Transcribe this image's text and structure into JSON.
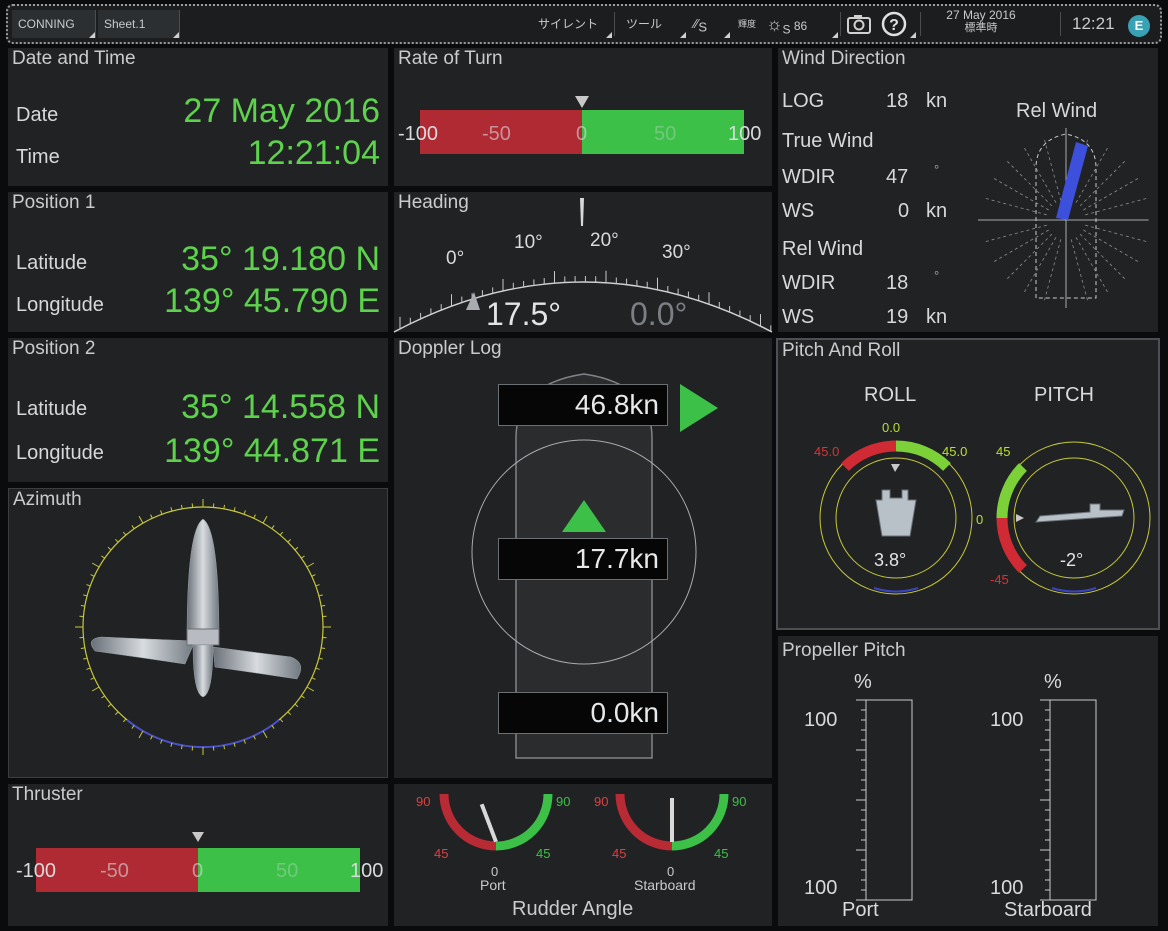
{
  "topbar": {
    "mode_button": "CONNING",
    "sheet_tab": "Sheet.1",
    "silent_button": "サイレント",
    "tools_button": "ツール",
    "panel_dimmer": "S",
    "brightness_label": "輝度",
    "brightness_value": "86",
    "date": "27 May 2016",
    "time_zone": "標準時",
    "clock": "12:21",
    "status_letter": "E"
  },
  "date_time": {
    "title": "Date and Time",
    "date_label": "Date",
    "date_value": "27 May 2016",
    "time_label": "Time",
    "time_value": "12:21:04"
  },
  "position1": {
    "title": "Position 1",
    "lat_label": "Latitude",
    "lat_value": "35° 19.180 N",
    "lon_label": "Longitude",
    "lon_value": "139° 45.790 E"
  },
  "position2": {
    "title": "Position 2",
    "lat_label": "Latitude",
    "lat_value": "35° 14.558 N",
    "lon_label": "Longitude",
    "lon_value": "139° 44.871 E"
  },
  "azimuth": {
    "title": "Azimuth"
  },
  "thruster": {
    "title": "Thruster",
    "scale": [
      "-100",
      "-50",
      "0",
      "50",
      "100"
    ],
    "value": 0
  },
  "rate_of_turn": {
    "title": "Rate of Turn",
    "scale": [
      "-100",
      "-50",
      "0",
      "50",
      "100"
    ],
    "value": 0
  },
  "heading": {
    "title": "Heading",
    "ticks": [
      "0°",
      "10°",
      "20°",
      "30°"
    ],
    "heading_value": "17.5°",
    "set_value": "0.0°"
  },
  "doppler_log": {
    "title": "Doppler Log",
    "fore_speed": "46.8kn",
    "center_speed": "17.7kn",
    "aft_speed": "0.0kn"
  },
  "rudder": {
    "title": "Rudder Angle",
    "port_label": "Port",
    "starboard_label": "Starboard",
    "scale_90": "90",
    "scale_45": "45",
    "scale_0": "0",
    "colors": {
      "port": "#c83030",
      "starboard": "#3cc83c"
    }
  },
  "wind": {
    "title": "Wind Direction",
    "log_label": "LOG",
    "log_value": "18",
    "log_unit": "kn",
    "true_wind_label": "True Wind",
    "true_wdir_label": "WDIR",
    "true_wdir_value": "47",
    "true_wdir_unit": "°",
    "true_ws_label": "WS",
    "true_ws_value": "0",
    "true_ws_unit": "kn",
    "rel_wind_label": "Rel Wind",
    "rel_wdir_label": "WDIR",
    "rel_wdir_value": "18",
    "rel_wdir_unit": "°",
    "rel_ws_label": "WS",
    "rel_ws_value": "19",
    "rel_ws_unit": "kn",
    "rel_wind_graphic_title": "Rel Wind",
    "arrow_color": "#3c50dc"
  },
  "pitch_roll": {
    "title": "Pitch And Roll",
    "roll_label": "ROLL",
    "pitch_label": "PITCH",
    "roll_top": "0.0",
    "roll_left": "45.0",
    "roll_right": "45.0",
    "roll_value": "3.8°",
    "pitch_top": "45",
    "pitch_mid": "0",
    "pitch_bottom": "-45",
    "pitch_value": "-2°"
  },
  "propeller": {
    "title": "Propeller Pitch",
    "unit": "%",
    "max_label": "100",
    "min_label": "100",
    "port_label": "Port",
    "starboard_label": "Starboard"
  }
}
